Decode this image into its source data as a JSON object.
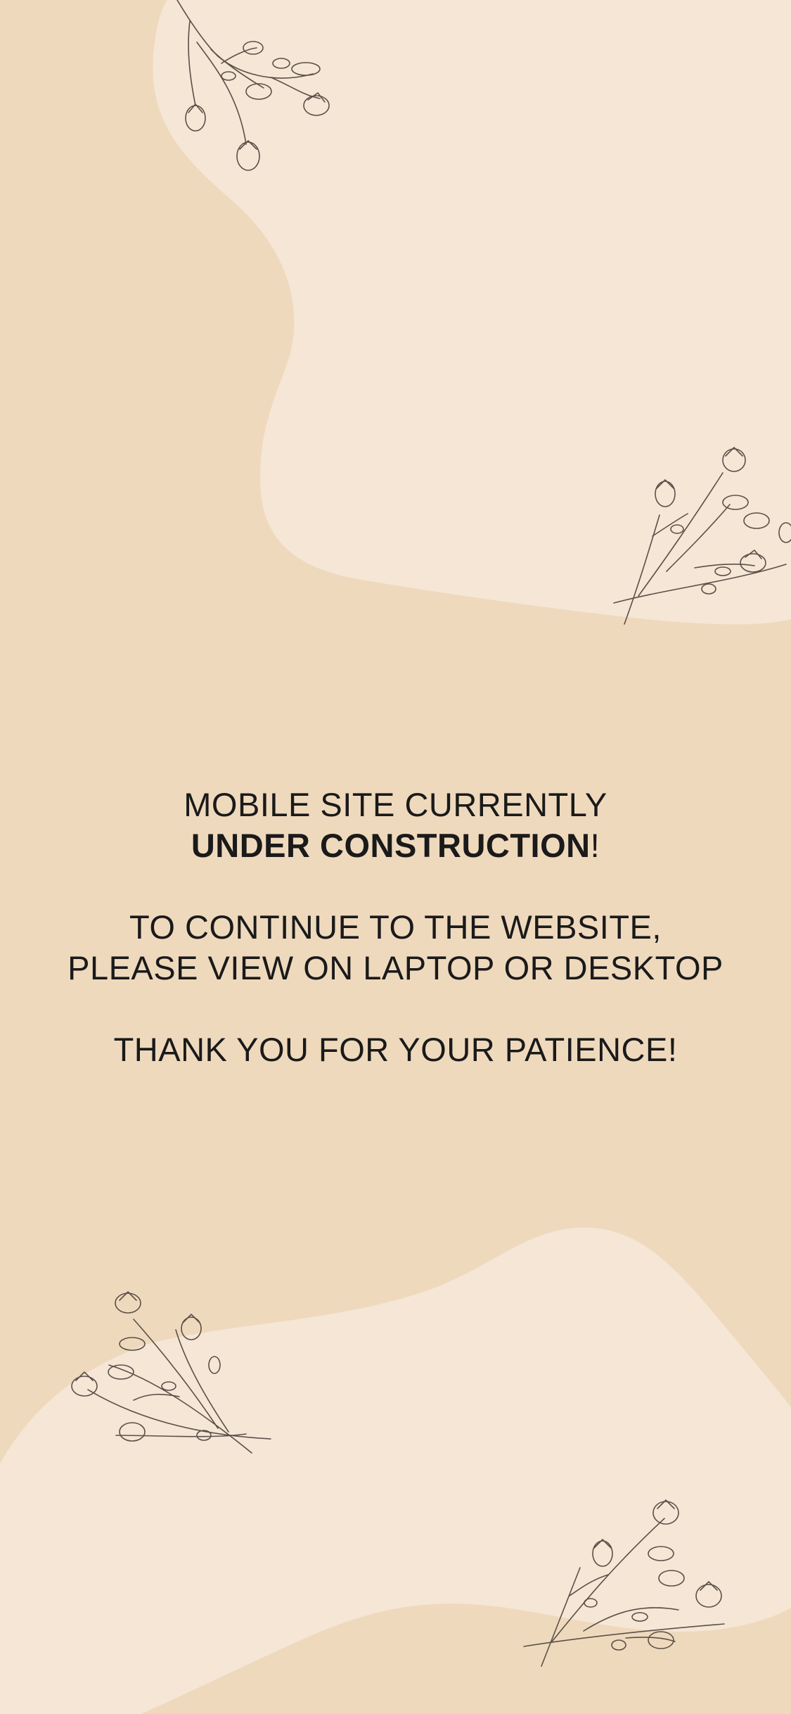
{
  "colors": {
    "background": "#efd9bd",
    "blob": "#f5e6d6",
    "text": "#1a1a1a",
    "floral_stroke": "#5a5048"
  },
  "message": {
    "line1": "MOBILE SITE CURRENTLY",
    "line2_strong": "UNDER CONSTRUCTION",
    "line2_suffix": "!",
    "line3": "TO CONTINUE TO THE WEBSITE,",
    "line4": "PLEASE VIEW ON LAPTOP OR DESKTOP",
    "line5": "THANK YOU FOR YOUR PATIENCE!"
  },
  "decorations": {
    "icons": [
      "floral-sprig-icon",
      "floral-sprig-icon",
      "floral-sprig-icon",
      "floral-sprig-icon"
    ]
  }
}
